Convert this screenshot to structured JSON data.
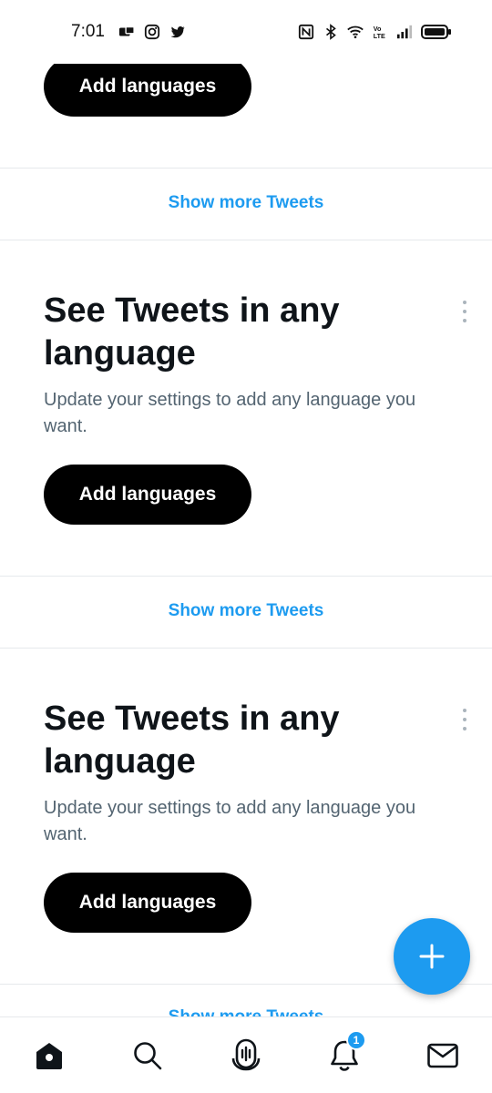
{
  "status_bar": {
    "time": "7:01",
    "left_icons": [
      "camera-notification-icon",
      "instagram-icon",
      "twitter-icon"
    ],
    "right_icons": [
      "nfc-icon",
      "bluetooth-icon",
      "wifi-icon",
      "volte-icon",
      "signal-icon",
      "battery-icon"
    ]
  },
  "feed": {
    "show_more_label": "Show more Tweets",
    "add_languages_label": "Add languages",
    "cards": [
      {
        "title": "See Tweets in any language",
        "subtitle": "Update your settings to add any language you want.",
        "button": "Add languages"
      },
      {
        "title": "See Tweets in any language",
        "subtitle": "Update your settings to add any language you want.",
        "button": "Add languages"
      }
    ]
  },
  "bottom_nav": {
    "items": [
      "home-icon",
      "search-icon",
      "spaces-icon",
      "notifications-icon",
      "messages-icon"
    ],
    "notification_badge": "1"
  },
  "colors": {
    "accent": "#1d9bf0",
    "primary_text": "#0f1419",
    "secondary_text": "#536471",
    "button_bg": "#000000"
  }
}
